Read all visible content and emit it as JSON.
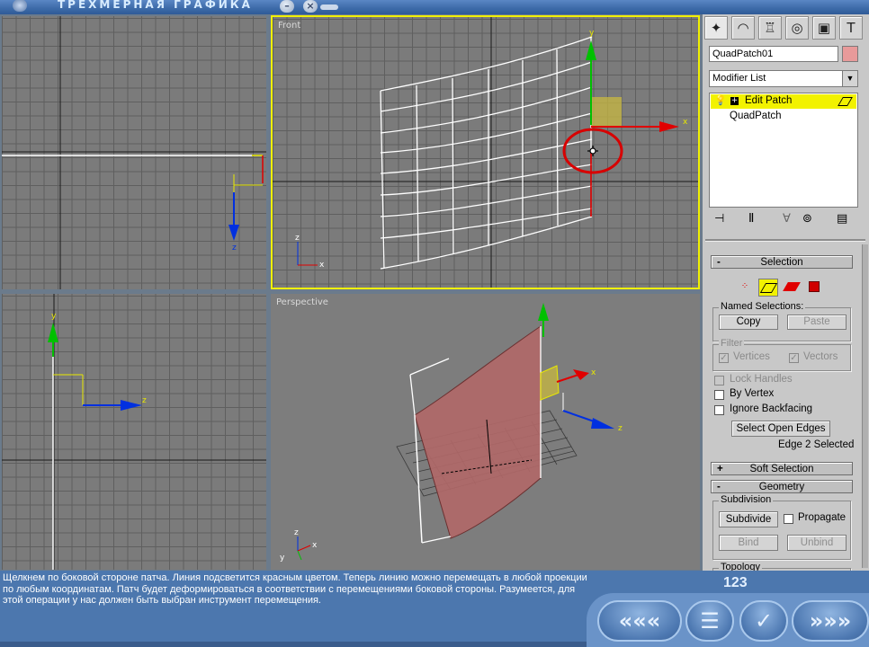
{
  "window": {
    "title": "ТРЕХМЕРНАЯ ГРАФИКА",
    "minimize_glyph": "–",
    "close_glyph": "×"
  },
  "viewports": {
    "front_label": "Front",
    "perspective_label": "Perspective",
    "axis_x": "x",
    "axis_y": "y",
    "axis_z": "z"
  },
  "command_panel": {
    "tabs": [
      {
        "icon": "create-icon",
        "glyph": "✦"
      },
      {
        "icon": "modify-icon",
        "glyph": "◠"
      },
      {
        "icon": "hierarchy-icon",
        "glyph": "♖"
      },
      {
        "icon": "motion-icon",
        "glyph": "◎"
      },
      {
        "icon": "display-icon",
        "glyph": "▣"
      },
      {
        "icon": "utilities-icon",
        "glyph": "T"
      }
    ],
    "object_name": "QuadPatch01",
    "object_color": "#e89a9a",
    "modifier_list": "Modifier List",
    "stack": [
      {
        "label": "Edit Patch",
        "selected": true
      },
      {
        "label": "QuadPatch",
        "selected": false
      }
    ],
    "selection": {
      "header": "Selection",
      "named_selections_label": "Named Selections:",
      "copy": "Copy",
      "paste": "Paste",
      "filter_label": "Filter",
      "vertices": "Vertices",
      "vectors": "Vectors",
      "lock_handles": "Lock Handles",
      "by_vertex": "By Vertex",
      "ignore_backfacing": "Ignore Backfacing",
      "select_open_edges": "Select Open Edges",
      "status": "Edge 2 Selected"
    },
    "soft_selection": {
      "header": "Soft Selection",
      "sign": "+"
    },
    "geometry": {
      "header": "Geometry",
      "sign": "-",
      "subdivision_label": "Subdivision",
      "subdivide": "Subdivide",
      "propagate": "Propagate",
      "bind": "Bind",
      "unbind": "Unbind",
      "topology_label": "Topology"
    }
  },
  "caption": "Щелкнем по боковой стороне патча. Линия подсветится красным цветом. Теперь линию можно перемещать в любой проекции по любым координатам. Патч будет деформироваться в соответствии с перемещениями боковой стороны. Разумеется, для этой операции у нас должен быть выбран инструмент перемещения.",
  "page_number": "123",
  "nav": {
    "back": "«««",
    "menu": "☰",
    "check": "✓",
    "forward": "»»»"
  },
  "colors": {
    "viewport_active_border": "#f0f000",
    "axis_x": "#e00000",
    "axis_y": "#00c000",
    "axis_z": "#0030e0",
    "patch": "#b06868"
  }
}
